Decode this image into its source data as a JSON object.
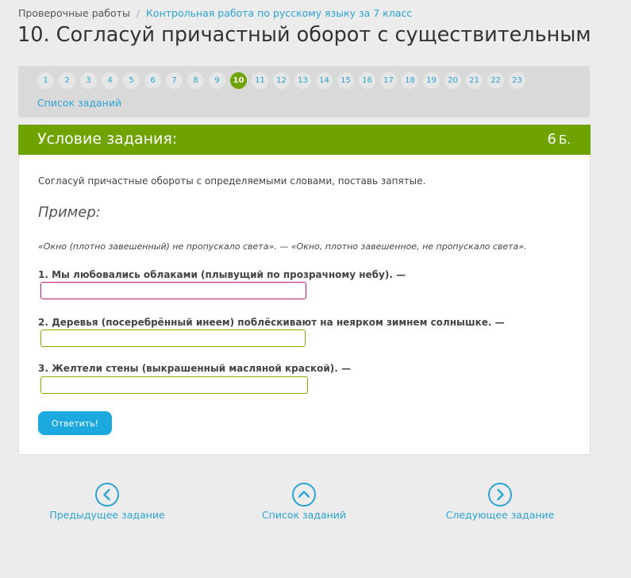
{
  "breadcrumb": {
    "home": "Проверочные работы",
    "separator": "/",
    "current": "Контрольная работа по русскому языку за 7 класс"
  },
  "page_title": "10. Согласуй причастный оборот с существительным",
  "task_nav": {
    "pills": [
      "1",
      "2",
      "3",
      "4",
      "5",
      "6",
      "7",
      "8",
      "9",
      "10",
      "11",
      "12",
      "13",
      "14",
      "15",
      "16",
      "17",
      "18",
      "19",
      "20",
      "21",
      "22",
      "23"
    ],
    "active": "10",
    "list_link": "Список заданий"
  },
  "task": {
    "header": "Условие задания:",
    "points_value": "6",
    "points_unit": "Б.",
    "condition": "Согласуй причастные обороты с определяемыми словами, поставь запятые.",
    "example_title": "Пример:",
    "example_text": "«Окно (плотно завешенный) не пропускало света». — «Окно, плотно завешенное, не пропускало света».",
    "questions": [
      {
        "text": "1. Мы любовались облаками (плывущий по прозрачному небу). —",
        "value": ""
      },
      {
        "text": "2. Деревья (посеребрённый инеем) поблёскивают на неярком зимнем солнышке. —",
        "value": ""
      },
      {
        "text": "3. Желтели стены (выкрашенный масляной краской). —",
        "value": ""
      }
    ],
    "submit_label": "Ответить!"
  },
  "bottom_nav": {
    "prev_label": "Предыдущее задание",
    "list_label": "Список заданий",
    "next_label": "Следующее задание"
  },
  "colors": {
    "accent_green": "#6fa300",
    "link_blue": "#2aa3d6",
    "button_blue": "#1ba9df",
    "focus_border": "#c0187c"
  }
}
